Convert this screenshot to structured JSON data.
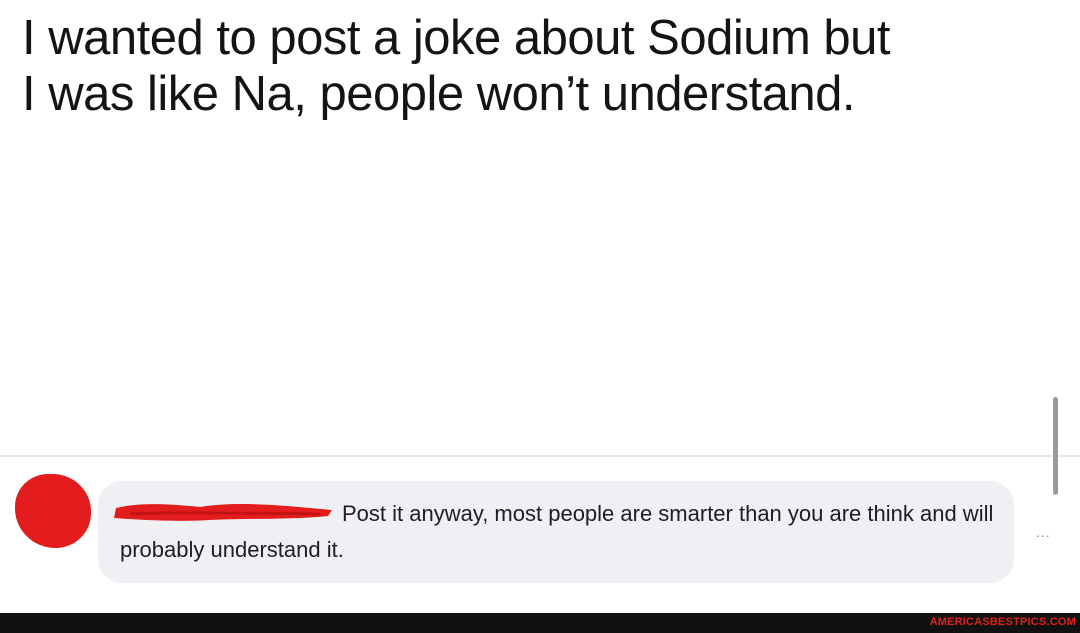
{
  "post": {
    "line1": "I wanted to post a joke about Sodium but",
    "line2": "I was like Na, people won’t understand."
  },
  "comment": {
    "text": "Post it anyway, most people are smarter than you are think and will probably understand it."
  },
  "more_menu": {
    "label": "..."
  },
  "footer": {
    "watermark": "AMERICASBESTPICS.COM"
  },
  "colors": {
    "redaction": "#e31d1d",
    "bubble": "#eef0f3",
    "footer": "#111111",
    "watermark": "#e0211c"
  }
}
